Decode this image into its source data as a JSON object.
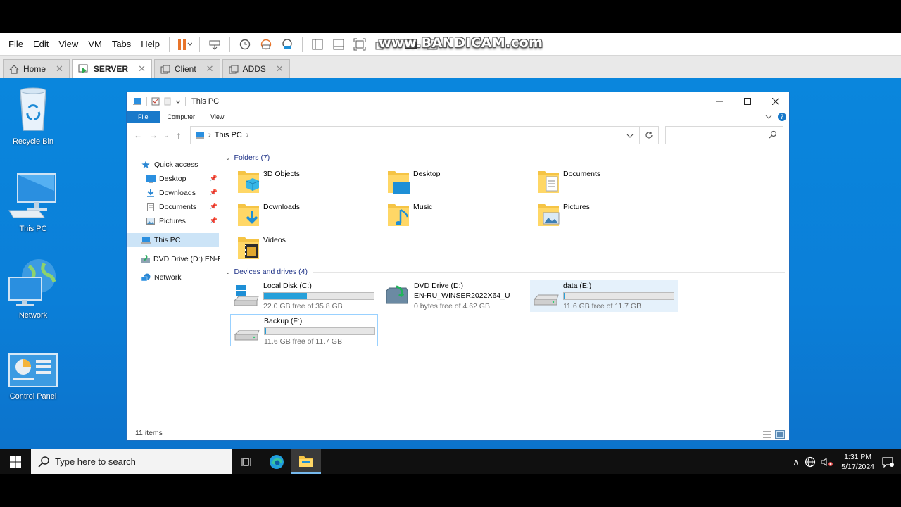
{
  "vm": {
    "menu": [
      "File",
      "Edit",
      "View",
      "VM",
      "Tabs",
      "Help"
    ],
    "tabs": [
      {
        "label": "Home",
        "active": false
      },
      {
        "label": "SERVER",
        "active": true
      },
      {
        "label": "Client",
        "active": false
      },
      {
        "label": "ADDS",
        "active": false
      }
    ],
    "watermark": "www.BANDICAM.com"
  },
  "desktop_icons": [
    {
      "label": "Recycle Bin",
      "icon": "recycle-bin-icon"
    },
    {
      "label": "This PC",
      "icon": "computer-icon"
    },
    {
      "label": "Network",
      "icon": "network-icon"
    },
    {
      "label": "Control Panel",
      "icon": "control-panel-icon"
    }
  ],
  "explorer": {
    "title": "This PC",
    "ribbon_tabs": [
      "File",
      "Computer",
      "View"
    ],
    "address": {
      "crumb": "This PC"
    },
    "search_placeholder": "",
    "nav": {
      "quick_access": "Quick access",
      "items": [
        "Desktop",
        "Downloads",
        "Documents",
        "Pictures"
      ],
      "this_pc": "This PC",
      "dvd": "DVD Drive (D:) EN-RU",
      "network": "Network"
    },
    "folders_header": "Folders (7)",
    "folders": [
      "3D Objects",
      "Desktop",
      "Documents",
      "Downloads",
      "Music",
      "Pictures",
      "Videos"
    ],
    "devices_header": "Devices and drives (4)",
    "drives": [
      {
        "name": "Local Disk (C:)",
        "free": "22.0 GB free of 35.8 GB",
        "used_fraction": 0.39
      },
      {
        "name": "DVD Drive (D:)",
        "label": "EN-RU_WINSER2022X64_U",
        "free": "0 bytes free of 4.62 GB"
      },
      {
        "name": "data (E:)",
        "free": "11.6 GB free of 11.7 GB",
        "used_fraction": 0.01
      },
      {
        "name": "Backup (F:)",
        "free": "11.6 GB free of 11.7 GB",
        "used_fraction": 0.01
      }
    ],
    "status": "11 items"
  },
  "taskbar": {
    "search_placeholder": "Type here to search",
    "time": "1:31 PM",
    "date": "5/17/2024"
  }
}
